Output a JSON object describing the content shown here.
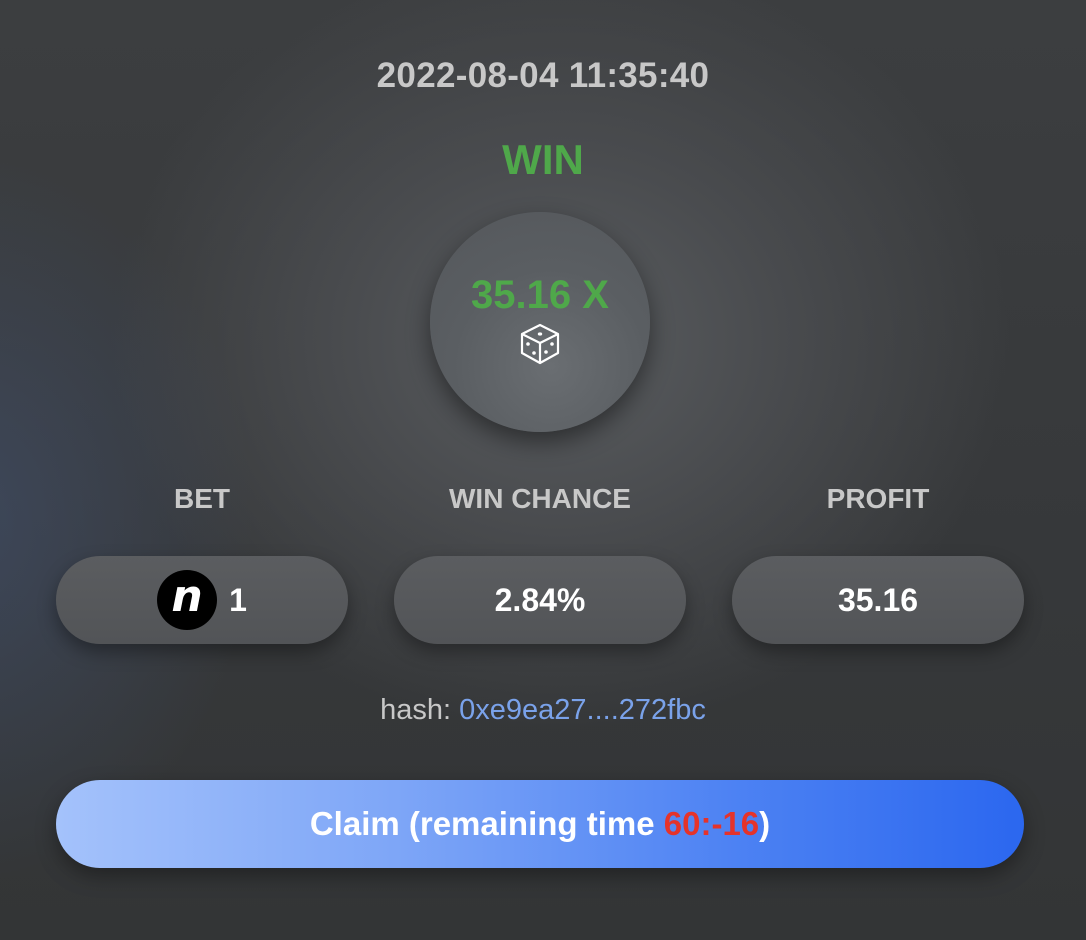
{
  "header": {
    "timestamp": "2022-08-04 11:35:40",
    "result": "WIN"
  },
  "multiplier": {
    "value": "35.16 X",
    "icon": "dice-icon"
  },
  "stats": {
    "bet": {
      "label": "BET",
      "value": "1",
      "token_icon": "n-token-icon",
      "token_letter": "n"
    },
    "win_chance": {
      "label": "WIN CHANCE",
      "value": "2.84%"
    },
    "profit": {
      "label": "PROFIT",
      "value": "35.16"
    }
  },
  "hash": {
    "label": "hash:",
    "value": "0xe9ea27....272fbc"
  },
  "claim": {
    "prefix": "Claim (remaining time ",
    "time": "60:-16",
    "suffix": ")"
  },
  "colors": {
    "win": "#4fa84a",
    "hash_link": "#7aa2ea",
    "claim_time": "#e5332a",
    "button_start": "#a4c2fb",
    "button_end": "#2b67ef"
  }
}
